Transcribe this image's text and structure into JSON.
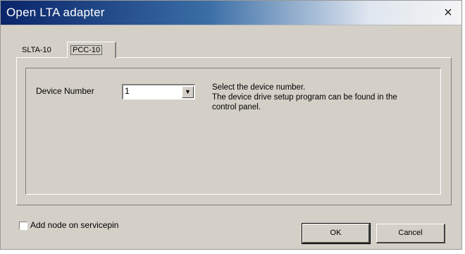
{
  "window": {
    "title": "Open LTA adapter",
    "close_glyph": "×"
  },
  "tabs": [
    {
      "label": "SLTA-10",
      "active": false
    },
    {
      "label": "PCC-10",
      "active": true
    }
  ],
  "form": {
    "device_number_label": "Device Number",
    "device_number_value": "1",
    "dropdown_icon": "chevron-down-icon",
    "help_lines": [
      "Select the device number.",
      "The device drive setup program can be found in the",
      "control panel."
    ]
  },
  "footer": {
    "checkbox_label": "Add node on servicepin",
    "checkbox_checked": false,
    "ok_label": "OK",
    "cancel_label": "Cancel"
  },
  "colors": {
    "face": "#d4d0c8",
    "title_start": "#0a246a",
    "title_end": "#f4f4f4"
  }
}
